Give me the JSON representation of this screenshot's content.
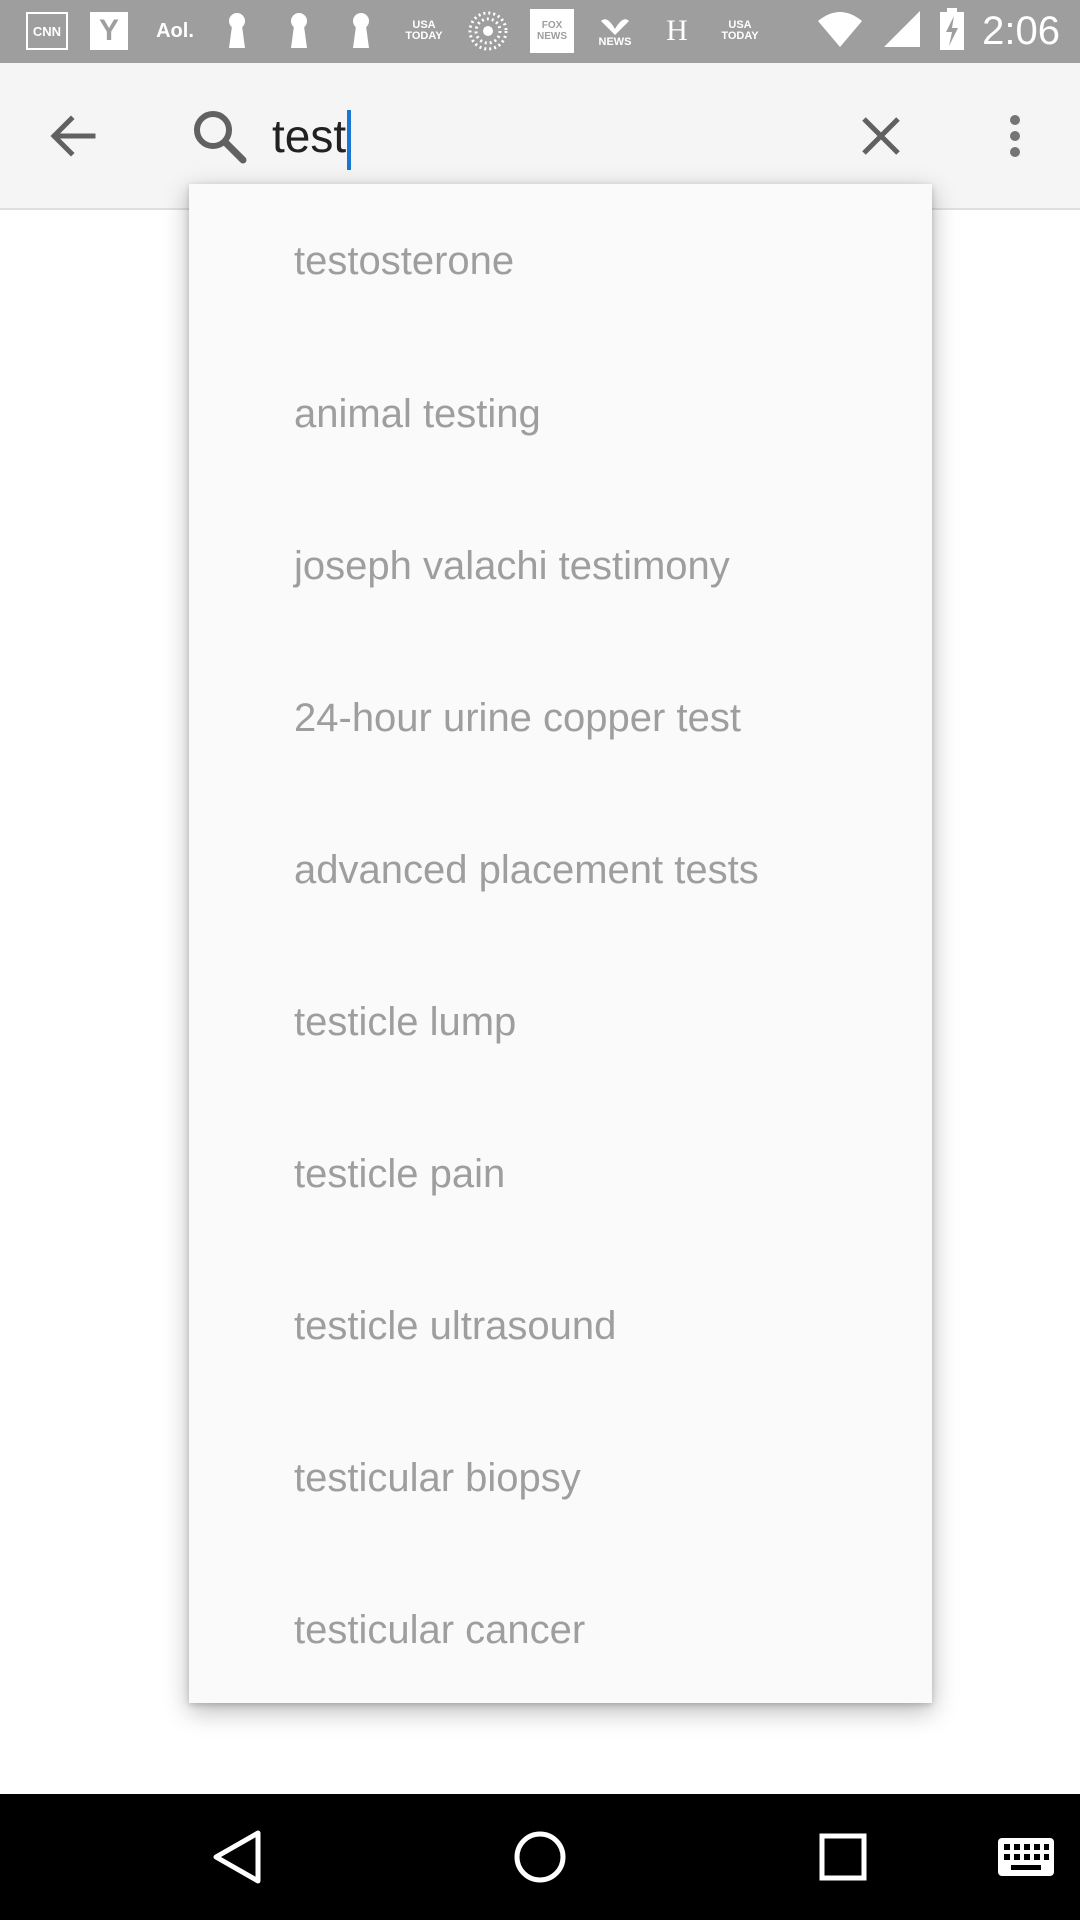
{
  "status_bar": {
    "time": "2:06",
    "notifications": [
      {
        "name": "cnn-icon",
        "label": "CNN"
      },
      {
        "name": "yahoo-icon",
        "label": "Y"
      },
      {
        "name": "aol-icon",
        "label": "Aol."
      },
      {
        "name": "keyhole-icon-1",
        "label": ""
      },
      {
        "name": "keyhole-icon-2",
        "label": ""
      },
      {
        "name": "keyhole-icon-3",
        "label": ""
      },
      {
        "name": "usa-today-icon",
        "label": "USA TODAY"
      },
      {
        "name": "dots-circle-icon",
        "label": ""
      },
      {
        "name": "fox-news-icon",
        "label": "FOX NEWS"
      },
      {
        "name": "nbc-news-icon",
        "label": "NEWS"
      },
      {
        "name": "history-icon",
        "label": "H"
      },
      {
        "name": "usa-today-icon-2",
        "label": "USA TODAY"
      }
    ],
    "icons": [
      "wifi-icon",
      "signal-icon",
      "battery-charging-icon"
    ]
  },
  "search": {
    "query": "test",
    "icons": [
      "back-arrow-icon",
      "search-icon",
      "close-icon",
      "more-vert-icon"
    ]
  },
  "suggestions": [
    "testosterone",
    "animal testing",
    "joseph valachi testimony",
    "24-hour urine copper test",
    "advanced placement tests",
    "testicle lump",
    "testicle pain",
    "testicle ultrasound",
    "testicular biopsy",
    "testicular cancer"
  ],
  "nav_bar": {
    "icons": [
      "nav-back-icon",
      "nav-home-icon",
      "nav-recents-icon",
      "keyboard-icon"
    ]
  }
}
